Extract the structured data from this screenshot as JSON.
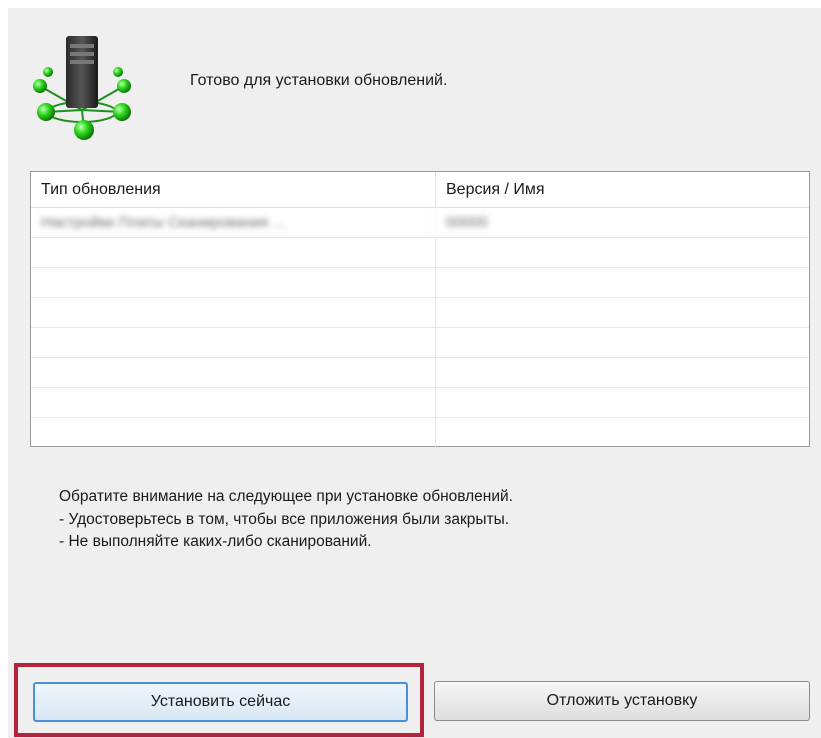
{
  "header": {
    "message": "Готово для установки обновлений.",
    "icon": "server-network-icon",
    "accent_green": "#33cc33"
  },
  "list": {
    "columns": [
      "Тип обновления",
      "Версия / Имя"
    ],
    "rows": [
      [
        "Настройки Платы Сканирования ...",
        "00000"
      ],
      [
        "",
        ""
      ],
      [
        "",
        ""
      ],
      [
        "",
        ""
      ],
      [
        "",
        ""
      ],
      [
        "",
        ""
      ],
      [
        "",
        ""
      ],
      [
        "",
        ""
      ]
    ]
  },
  "notes": {
    "line1": "Обратите внимание на следующее при установке обновлений.",
    "line2": "- Удостоверьтесь в том, чтобы все приложения были закрыты.",
    "line3": "- Не выполняйте каких-либо сканирований."
  },
  "buttons": {
    "install": "Установить сейчас",
    "postpone": "Отложить установку"
  },
  "colors": {
    "highlight": "#b3253a",
    "focus": "#4a90d9"
  }
}
